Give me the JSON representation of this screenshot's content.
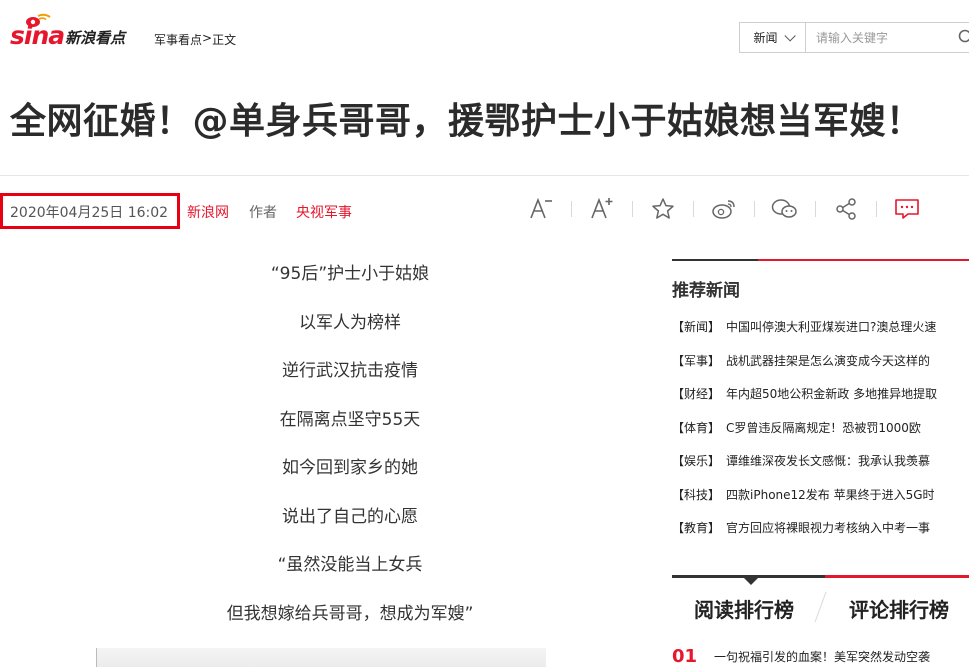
{
  "header": {
    "logo_text": "sina",
    "logo_sub": "新浪看点",
    "breadcrumb": {
      "section": "军事看点",
      "separator": ">",
      "current": "正文"
    },
    "search": {
      "category": "新闻",
      "placeholder": "请输入关键字"
    }
  },
  "article": {
    "title": "全网征婚！@单身兵哥哥，援鄂护士小于姑娘想当军嫂！",
    "date": "2020年04月25日 16:02",
    "source": "新浪网",
    "author_label": "作者",
    "author": "央视军事",
    "paragraphs": [
      "“95后”护士小于姑娘",
      "以军人为榜样",
      "逆行武汉抗击疫情",
      "在隔离点坚守55天",
      "如今回到家乡的她",
      "说出了自己的心愿",
      "“虽然没能当上女兵",
      "但我想嫁给兵哥哥，想成为军嫂”"
    ]
  },
  "toolbar": {
    "icons": [
      "font-decrease-icon",
      "font-increase-icon",
      "star-icon",
      "weibo-icon",
      "wechat-icon",
      "share-icon",
      "comment-icon"
    ],
    "accent_color": "#e6162d"
  },
  "sidebar": {
    "recommended_title": "推荐新闻",
    "news": [
      {
        "category": "【新闻】",
        "text": "中国叫停澳大利亚煤炭进口?澳总理火速"
      },
      {
        "category": "【军事】",
        "text": "战机武器挂架是怎么演变成今天这样的"
      },
      {
        "category": "【财经】",
        "text": "年内超50地公积金新政 多地推异地提取"
      },
      {
        "category": "【体育】",
        "text": "C罗曾违反隔离规定！恐被罚1000欧"
      },
      {
        "category": "【娱乐】",
        "text": "谭维维深夜发长文感慨：我承认我羡慕"
      },
      {
        "category": "【科技】",
        "text": "四款iPhone12发布 苹果终于进入5G时"
      },
      {
        "category": "【教育】",
        "text": "官方回应将裸眼视力考核纳入中考一事"
      }
    ],
    "rank_tabs": {
      "read": "阅读排行榜",
      "comment": "评论排行榜"
    },
    "rank_items": [
      {
        "no": "01",
        "text": "一句祝福引发的血案！美军突然发动空袭"
      }
    ]
  }
}
